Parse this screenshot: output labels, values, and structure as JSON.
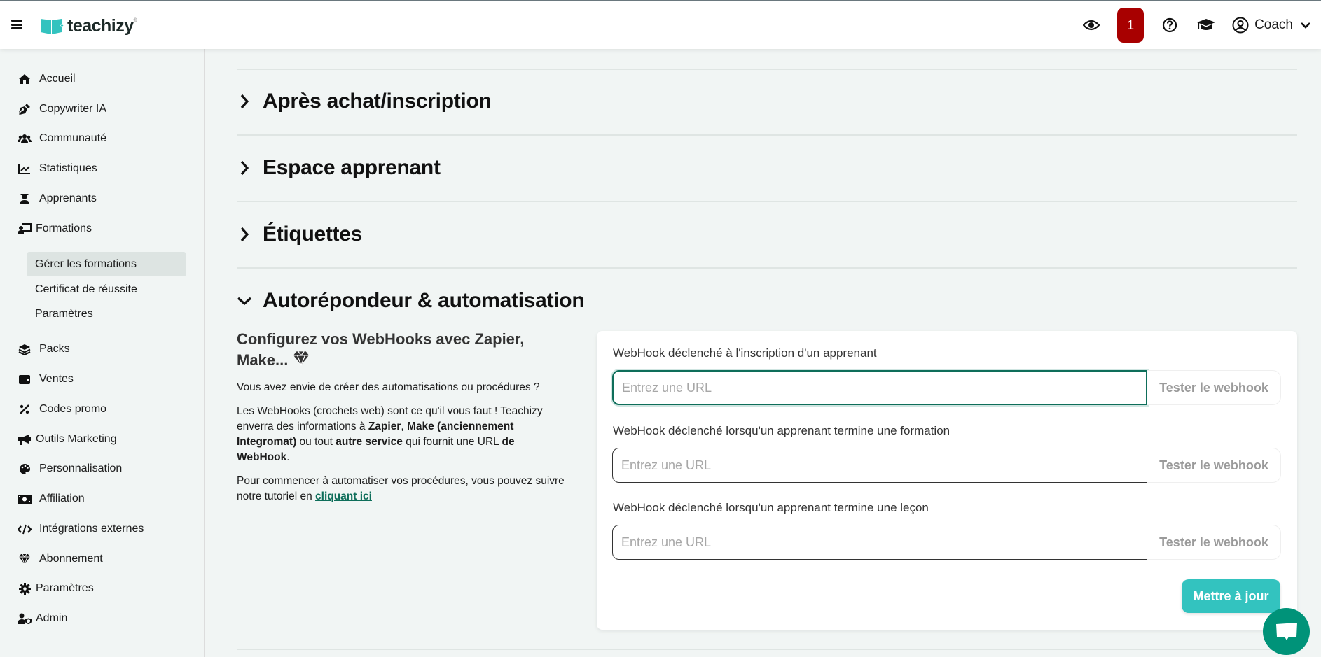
{
  "header": {
    "brand": "teachizy",
    "brand_reg": "®",
    "notification_count": "1",
    "user_name": "Coach",
    "brand_color": "#33c3bf",
    "badge_color": "#a80000"
  },
  "sidebar": {
    "items": [
      {
        "label": "Accueil",
        "icon": "home-icon"
      },
      {
        "label": "Copywriter IA",
        "icon": "pen-nib-icon"
      },
      {
        "label": "Communauté",
        "icon": "users-icon"
      },
      {
        "label": "Statistiques",
        "icon": "chart-line-icon"
      },
      {
        "label": "Apprenants",
        "icon": "graduate-icon"
      },
      {
        "label": "Formations",
        "icon": "chalkboard-teacher-icon"
      },
      {
        "label": "Packs",
        "icon": "layers-icon"
      },
      {
        "label": "Ventes",
        "icon": "wallet-icon"
      },
      {
        "label": "Codes promo",
        "icon": "percent-icon"
      },
      {
        "label": "Outils Marketing",
        "icon": "megaphone-icon"
      },
      {
        "label": "Personnalisation",
        "icon": "palette-icon"
      },
      {
        "label": "Affiliation",
        "icon": "money-bill-icon"
      },
      {
        "label": "Intégrations externes",
        "icon": "code-icon"
      },
      {
        "label": "Abonnement",
        "icon": "gem-icon"
      },
      {
        "label": "Paramètres",
        "icon": "gear-icon"
      },
      {
        "label": "Admin",
        "icon": "user-shield-icon"
      }
    ],
    "sub_items": [
      {
        "label": "Gérer les formations",
        "active": true
      },
      {
        "label": "Certificat de réussite",
        "active": false
      },
      {
        "label": "Paramètres",
        "active": false
      }
    ]
  },
  "main": {
    "sections": [
      {
        "title": "Après achat/inscription",
        "expanded": false
      },
      {
        "title": "Espace apprenant",
        "expanded": false
      },
      {
        "title": "Étiquettes",
        "expanded": false
      },
      {
        "title": "Autorépondeur & automatisation",
        "expanded": true
      }
    ],
    "intro": {
      "heading": "Configurez vos WebHooks avec Zapier, Make...",
      "p1": "Vous avez envie de créer des automatisations ou procédures ?",
      "p2_a": "Les WebHooks (crochets web) sont ce qu'il vous faut ! Teachizy enverra des informations à ",
      "p2_zapier": "Zapier",
      "p2_comma": ", ",
      "p2_make": "Make (anciennement Integromat)",
      "p2_b": " ou tout ",
      "p2_service": "autre service",
      "p2_c": " qui fournit une URL ",
      "p2_webhook": "de WebHook",
      "p2_end": ".",
      "p3": "Pour commencer à automatiser vos procédures, vous pouvez suivre notre tutoriel en ",
      "link": "cliquant ici"
    },
    "webhooks": [
      {
        "label": "WebHook déclenché à l'inscription d'un apprenant",
        "placeholder": "Entrez une URL",
        "value": "",
        "button": "Tester le webhook"
      },
      {
        "label": "WebHook déclenché lorsqu'un apprenant termine une formation",
        "placeholder": "Entrez une URL",
        "value": "",
        "button": "Tester le webhook"
      },
      {
        "label": "WebHook déclenché lorsqu'un apprenant termine une leçon",
        "placeholder": "Entrez une URL",
        "value": "",
        "button": "Tester le webhook"
      }
    ],
    "update_button": "Mettre à jour"
  }
}
